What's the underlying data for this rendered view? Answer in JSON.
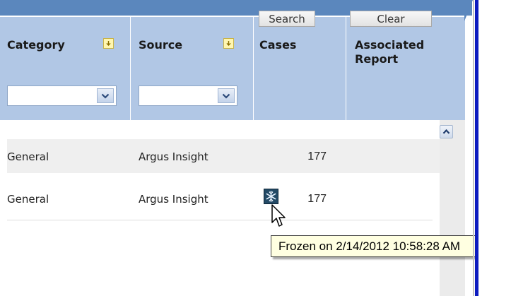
{
  "toolbar": {
    "search_label": "Search",
    "clear_label": "Clear"
  },
  "columns": [
    {
      "label": "Category",
      "sortable": true,
      "filter_value": ""
    },
    {
      "label": "Source",
      "sortable": true,
      "filter_value": ""
    },
    {
      "label": "Cases",
      "sortable": false
    },
    {
      "label": "Associated Report",
      "sortable": false
    }
  ],
  "rows": [
    {
      "category": "General",
      "source": "Argus Insight",
      "cases": "177",
      "associated_report": "",
      "frozen": false
    },
    {
      "category": "General",
      "source": "Argus Insight",
      "cases": "177",
      "associated_report": "",
      "frozen": true
    }
  ],
  "tooltip": {
    "text": "Frozen on 2/14/2012 10:58:28 AM"
  },
  "icons": {
    "sort": "sort-icon",
    "dropdown": "chevron-down-icon",
    "scroll_up": "chevron-up-icon",
    "frozen": "snowflake-icon",
    "cursor": "mouse-pointer-icon"
  },
  "colors": {
    "header_band": "#5b87bd",
    "header_bg": "#b1c7e5",
    "row_alt": "#efefef",
    "tooltip_bg": "#ffffe1",
    "right_bar": "#0d1bbf"
  }
}
